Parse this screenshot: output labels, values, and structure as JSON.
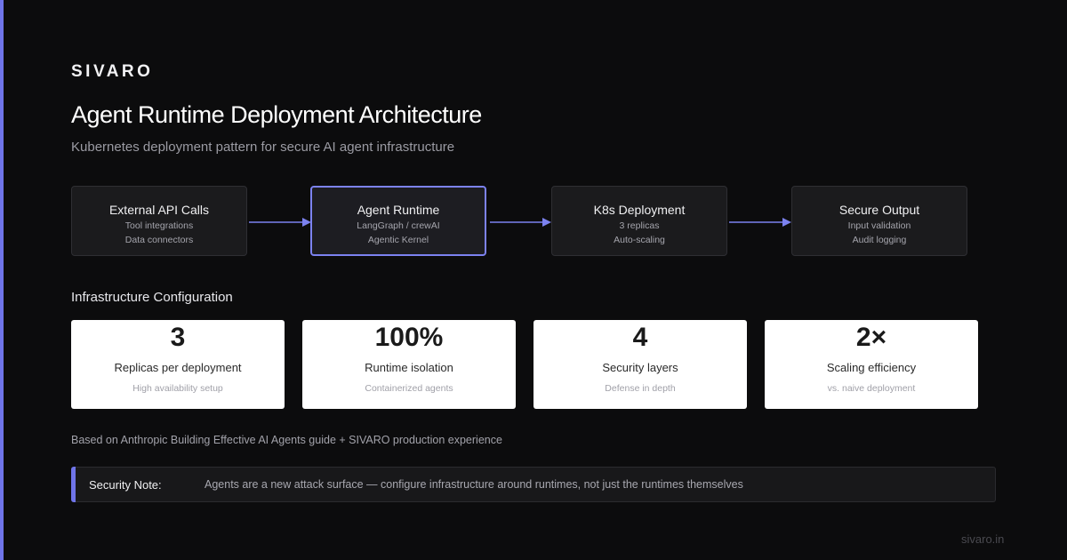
{
  "brand": "SIVARO",
  "title": "Agent Runtime Deployment Architecture",
  "subtitle": "Kubernetes deployment pattern for secure AI agent infrastructure",
  "colors": {
    "accent": "#6f74e8",
    "background": "#0c0c0d",
    "card": "#ffffff"
  },
  "flow": [
    {
      "title": "External API Calls",
      "line1": "Tool integrations",
      "line2": "Data connectors",
      "highlight": false
    },
    {
      "title": "Agent Runtime",
      "line1": "LangGraph / crewAI",
      "line2": "Agentic Kernel",
      "highlight": true
    },
    {
      "title": "K8s Deployment",
      "line1": "3 replicas",
      "line2": "Auto-scaling",
      "highlight": false
    },
    {
      "title": "Secure Output",
      "line1": "Input validation",
      "line2": "Audit logging",
      "highlight": false
    }
  ],
  "section_title": "Infrastructure Configuration",
  "stats": [
    {
      "value": "3",
      "label": "Replicas per deployment",
      "sub": "High availability setup"
    },
    {
      "value": "100%",
      "label": "Runtime isolation",
      "sub": "Containerized agents"
    },
    {
      "value": "4",
      "label": "Security layers",
      "sub": "Defense in depth"
    },
    {
      "value": "2×",
      "label": "Scaling efficiency",
      "sub": "vs. naive deployment"
    }
  ],
  "footnote": "Based on Anthropic Building Effective AI Agents guide + SIVARO production experience",
  "note": {
    "label": "Security Note:",
    "text": "Agents are a new attack surface — configure infrastructure around runtimes, not just the runtimes themselves"
  },
  "site": "sivaro.in"
}
